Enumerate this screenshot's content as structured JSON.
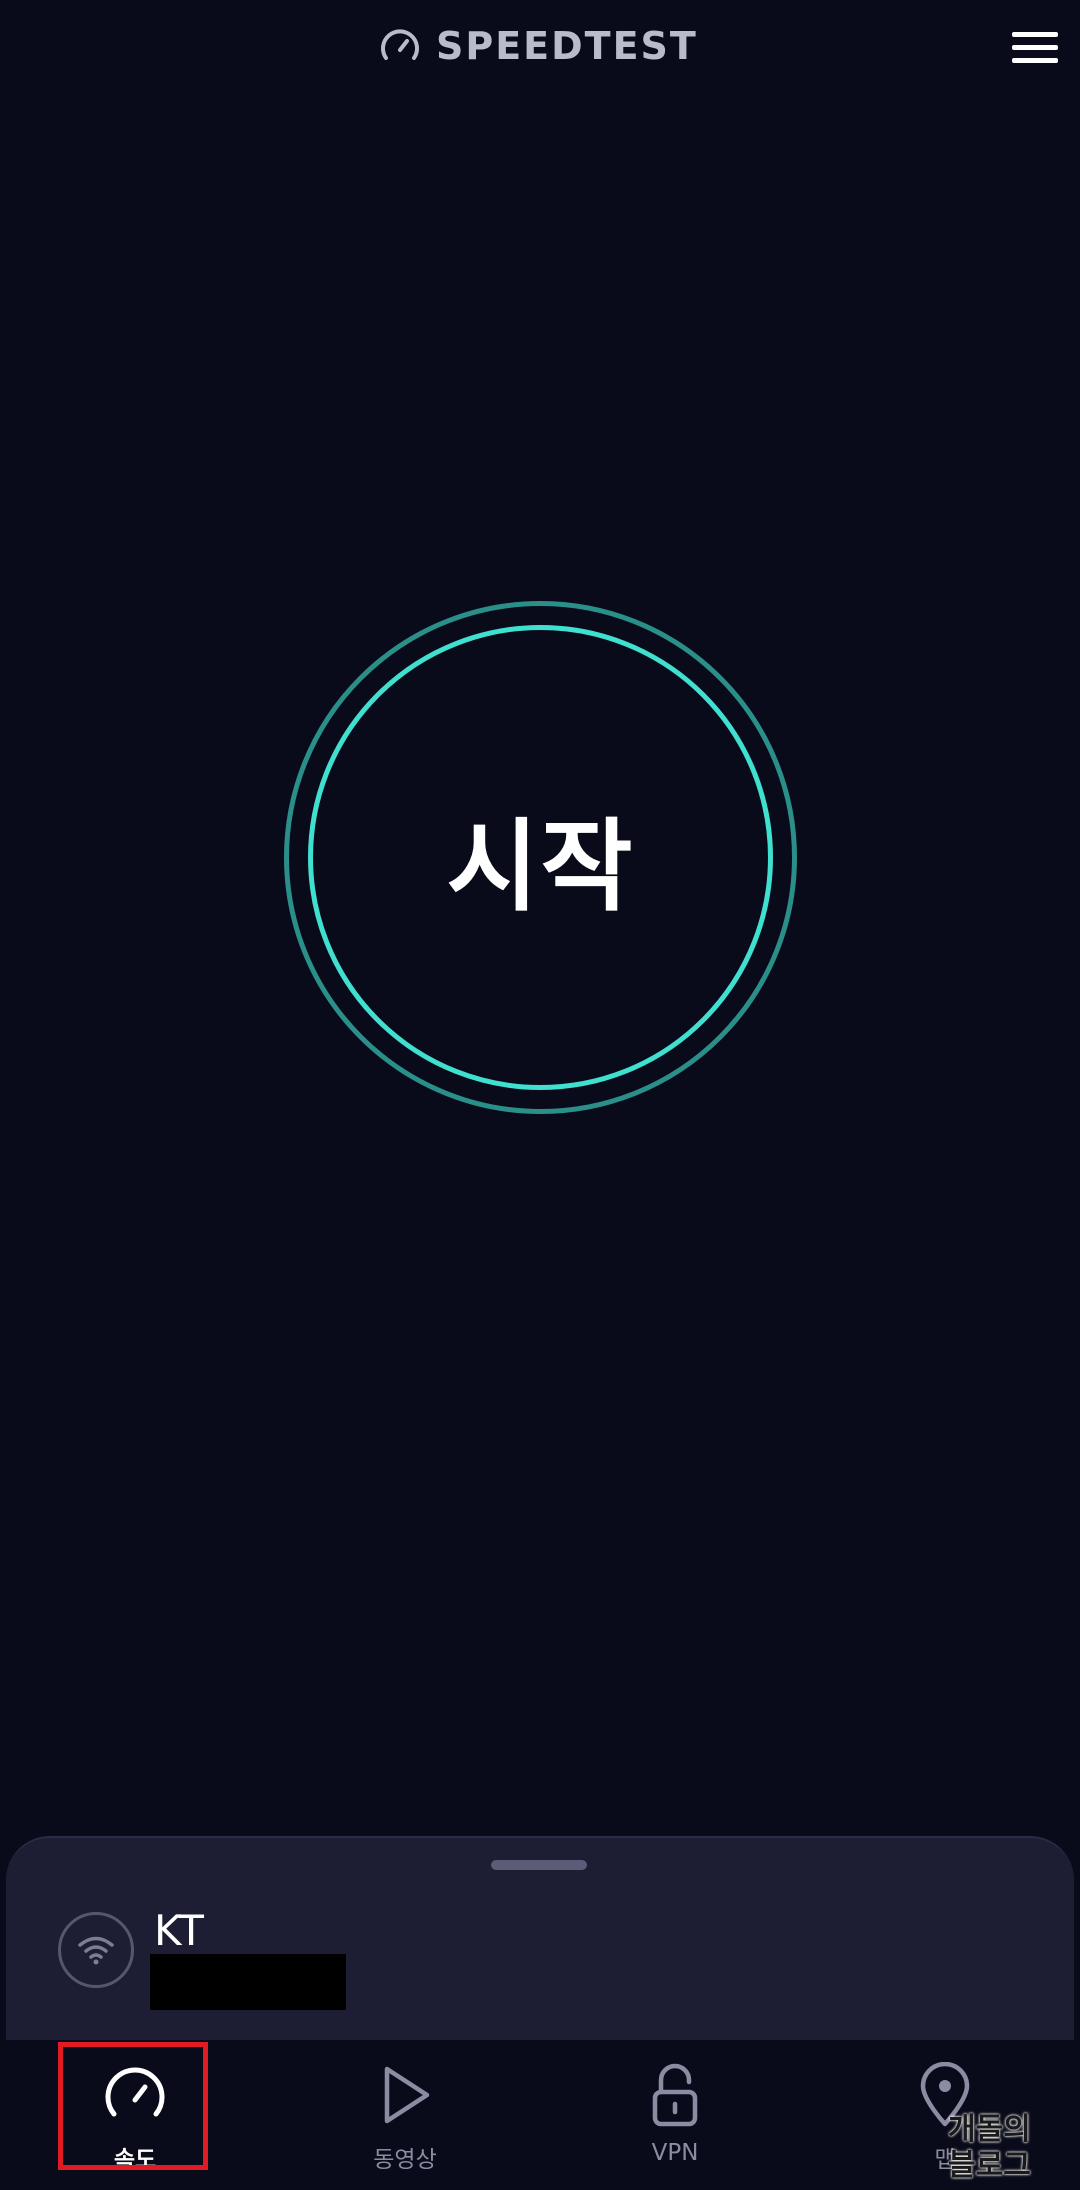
{
  "header": {
    "logo_text": "SPEEDTEST",
    "logo_icon": "speedometer-icon",
    "menu_icon": "hamburger-menu-icon"
  },
  "start_button": {
    "label": "시작"
  },
  "connection": {
    "provider": "KT",
    "connection_icon": "wifi-icon"
  },
  "bottom_nav": {
    "items": [
      {
        "label": "속도",
        "icon": "speedometer-icon",
        "active": true
      },
      {
        "label": "동영상",
        "icon": "play-icon",
        "active": false
      },
      {
        "label": "VPN",
        "icon": "unlock-icon",
        "active": false
      },
      {
        "label": "맵",
        "icon": "map-pin-icon",
        "active": false
      }
    ]
  },
  "watermark": {
    "line1": "개돌의",
    "line2": "블로그"
  },
  "colors": {
    "background": "#0a0b1a",
    "accent": "#3fe0cf",
    "sheet": "#1d1e33",
    "highlight": "#e01b24"
  }
}
